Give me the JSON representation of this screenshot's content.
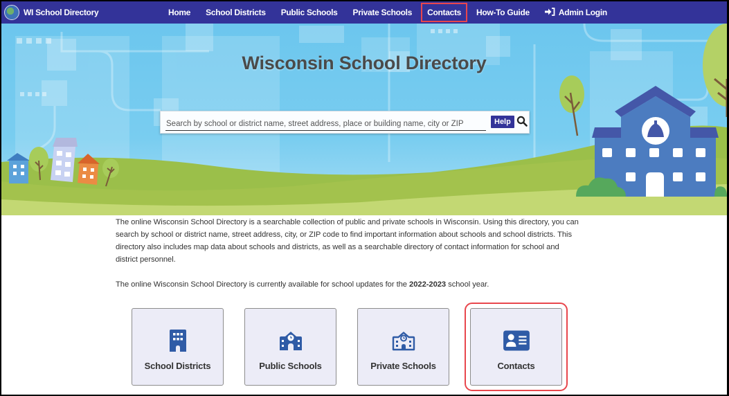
{
  "nav": {
    "brand": "WI School Directory",
    "links": [
      {
        "label": "Home"
      },
      {
        "label": "School Districts"
      },
      {
        "label": "Public Schools"
      },
      {
        "label": "Private Schools"
      },
      {
        "label": "Contacts",
        "highlighted": true
      },
      {
        "label": "How-To Guide"
      },
      {
        "label": "Admin Login",
        "icon": "login-icon"
      }
    ]
  },
  "hero": {
    "title": "Wisconsin School Directory",
    "search": {
      "placeholder": "Search by school or district name, street address, place or building name, city or ZIP",
      "value": "",
      "help_label": "Help",
      "search_icon": "search-icon"
    }
  },
  "intro": {
    "paragraph1": "The online Wisconsin School Directory is a searchable collection of public and private schools in Wisconsin. Using this directory, you can search by school or district name, street address, city, or ZIP code to find important information about schools and school districts. This directory also includes map data about schools and districts, as well as a searchable directory of contact information for school and district personnel.",
    "paragraph2_prefix": "The online Wisconsin School Directory is currently available for school updates for the ",
    "school_year": "2022-2023",
    "paragraph2_suffix": " school year."
  },
  "cards": [
    {
      "label": "School Districts",
      "icon": "building-icon"
    },
    {
      "label": "Public Schools",
      "icon": "school-icon"
    },
    {
      "label": "Private Schools",
      "icon": "school-outline-icon"
    },
    {
      "label": "Contacts",
      "icon": "contact-card-icon",
      "highlighted": true
    }
  ],
  "colors": {
    "nav_bg": "#333399",
    "accent_blue": "#2f5ba6",
    "highlight_red": "#e8464c",
    "card_bg": "#ececf7"
  }
}
